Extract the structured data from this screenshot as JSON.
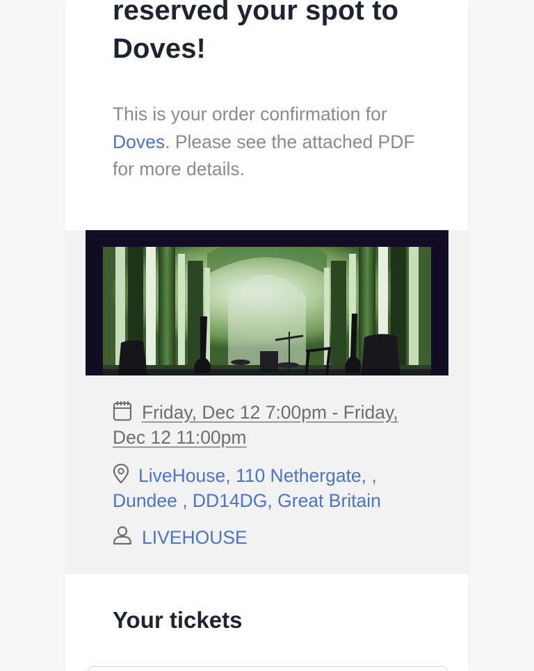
{
  "header": {
    "headline": "reserved your spot to Doves!"
  },
  "intro": {
    "before_link": "This is your order confirmation for ",
    "event_link": "Doves",
    "after_link": ". Please see the attached PDF for more details."
  },
  "event": {
    "image_icon": "concert-stage-image",
    "date_icon": "calendar-icon",
    "date_text": "Friday, Dec 12 7:00pm - Friday, Dec 12 11:00pm",
    "location_icon": "map-pin-icon",
    "location_text": "LiveHouse, 110 Nethergate, , Dundee , DD14DG, Great Britain",
    "organizer_icon": "user-icon",
    "organizer_text": "LIVEHOUSE"
  },
  "tickets": {
    "heading": "Your tickets"
  },
  "colors": {
    "link": "#4a74c9",
    "heading": "#1e2330",
    "body_text": "#8a8a8a",
    "panel_bg": "#f2f2f2"
  }
}
